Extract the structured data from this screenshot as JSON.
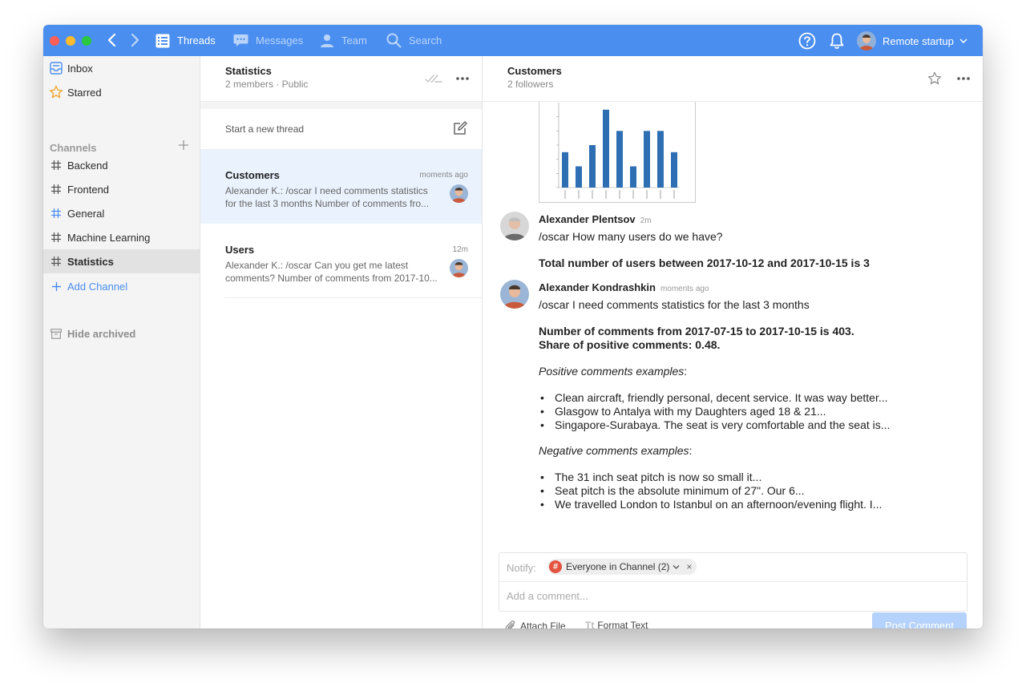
{
  "titlebar": {
    "nav": [
      {
        "label": "Threads",
        "icon": "list-icon"
      },
      {
        "label": "Messages",
        "icon": "chat-icon"
      },
      {
        "label": "Team",
        "icon": "person-icon"
      },
      {
        "label": "Search",
        "icon": "search-icon"
      }
    ],
    "account_name": "Remote startup",
    "accent": "#4a8ef0"
  },
  "sidebar": {
    "inbox": "Inbox",
    "starred": "Starred",
    "channels_heading": "Channels",
    "channels": [
      "Backend",
      "Frontend",
      "General",
      "Machine Learning",
      "Statistics"
    ],
    "active_channel": "Statistics",
    "add_channel": "Add Channel",
    "hide_archived": "Hide archived"
  },
  "thread_list": {
    "title": "Statistics",
    "subtitle": "2 members · Public",
    "new_thread": "Start a new thread",
    "threads": [
      {
        "title": "Customers",
        "time": "moments ago",
        "snippet": "Alexander K.: /oscar I need comments statistics for the last 3 months  Number of comments fro..."
      },
      {
        "title": "Users",
        "time": "12m",
        "snippet": "Alexander K.: /oscar Can you get me latest comments?  Number of comments from 2017-10..."
      }
    ]
  },
  "conversation": {
    "title": "Customers",
    "subtitle": "2 followers",
    "chart_thumb": {
      "values": [
        5,
        3,
        6,
        11,
        8,
        3,
        8,
        8,
        5
      ],
      "color": "#2e6fb4"
    },
    "messages": [
      {
        "author": "Alexander Plentsov",
        "time": "2m",
        "text": "/oscar How many users do we have?",
        "reply": "Total number of users between 2017-10-12 and 2017-10-15 is 3"
      },
      {
        "author": "Alexander Kondrashkin",
        "time": "moments ago",
        "text": "/oscar I need comments statistics for the last 3 months",
        "reply_line1": "Number of comments from 2017-07-15 to 2017-10-15 is 403.",
        "reply_line2": "Share of positive comments: 0.48.",
        "positive_heading": "Positive comments examples",
        "positive": [
          "Clean aircraft, friendly personal, decent service. It was way better...",
          "Glasgow to Antalya with my Daughters aged 18 & 21...",
          "Singapore-Surabaya. The seat is very comfortable and the seat is..."
        ],
        "negative_heading": "Negative comments examples",
        "negative": [
          "The 31 inch seat pitch is now so small it...",
          "Seat pitch is the absolute minimum of 27\". Our 6...",
          "We travelled London to Istanbul on an afternoon/evening flight. I..."
        ]
      }
    ]
  },
  "composer": {
    "notify_label": "Notify:",
    "chip_label": "Everyone in Channel (2)",
    "chip_icon": "#",
    "placeholder": "Add a comment...",
    "attach": "Attach File",
    "format_icon": "Tt",
    "format": "Format Text",
    "post": "Post Comment"
  }
}
